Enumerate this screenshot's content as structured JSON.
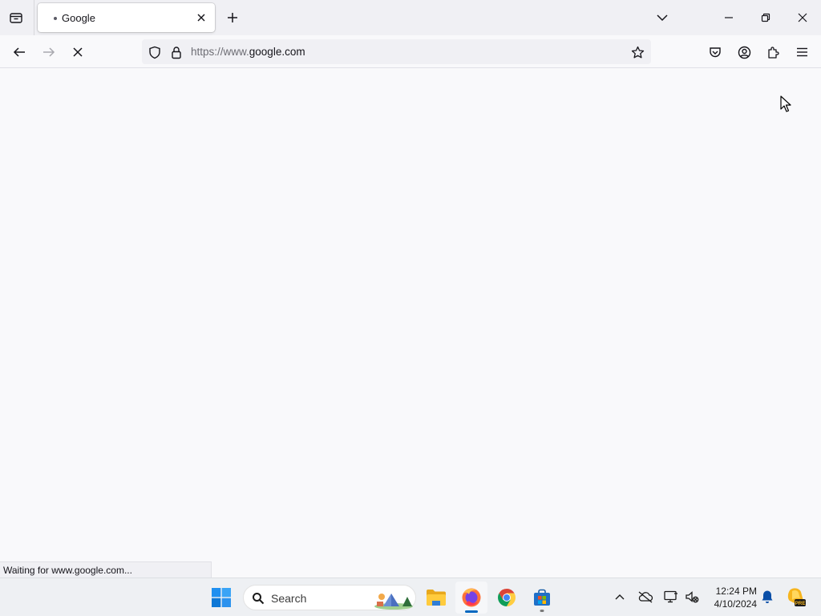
{
  "browser": {
    "tab": {
      "title": "Google",
      "loading": true
    },
    "address_bar": {
      "url_prefix": "https://www.",
      "url_host": "google.com"
    },
    "status_text": "Waiting for www.google.com..."
  },
  "taskbar": {
    "search_placeholder": "Search",
    "clock": {
      "time": "12:24 PM",
      "date": "4/10/2024"
    },
    "copilot_badge": "PRE"
  },
  "icons": {
    "tab_list": "tab-list-icon",
    "close_tab": "close-icon",
    "new_tab": "plus-icon",
    "all_tabs": "chevron-down-icon",
    "back": "arrow-left-icon",
    "forward": "arrow-right-icon",
    "stop": "stop-x-icon",
    "tracking_protection": "shield-icon",
    "secure": "lock-icon",
    "bookmark": "star-icon",
    "pocket": "pocket-icon",
    "account": "account-icon",
    "extensions": "puzzle-icon",
    "menu": "hamburger-icon"
  },
  "colors": {
    "tabstrip_bg": "#f0f0f4",
    "content_bg": "#f9f9fb",
    "taskbar_bg": "#eef0f3",
    "accent": "#0067c0"
  }
}
